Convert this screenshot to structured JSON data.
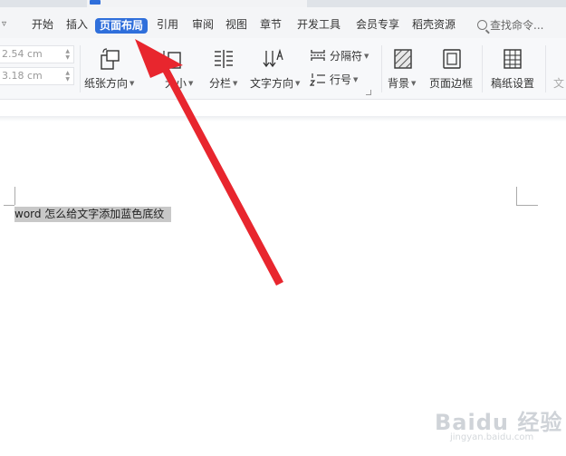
{
  "menu": {
    "collapse_arrow": "▿",
    "items": [
      "开始",
      "插入",
      "页面布局",
      "引用",
      "审阅",
      "视图",
      "章节",
      "开发工具",
      "会员专享",
      "稻壳资源"
    ],
    "active_index": 2,
    "search_placeholder": "查找命令..."
  },
  "ribbon": {
    "margin_top": "2.54 cm",
    "margin_bottom": "3.18 cm",
    "paper_direction": "纸张方向",
    "paper_size": "大小",
    "columns": "分栏",
    "text_direction": "文字方向",
    "separator": "分隔符",
    "line_number": "行号",
    "background": "背景",
    "page_border": "页面边框",
    "grid_paper": "稿纸设置",
    "cut_off": "文"
  },
  "document": {
    "selected_text": "word 怎么给文字添加蓝色底纹"
  },
  "watermark": {
    "brand": "Baidu 经验",
    "url": "jingyan.baidu.com"
  },
  "colors": {
    "accent": "#2f6fdb",
    "arrow": "#e8262e",
    "selection": "#c8c8c8"
  }
}
